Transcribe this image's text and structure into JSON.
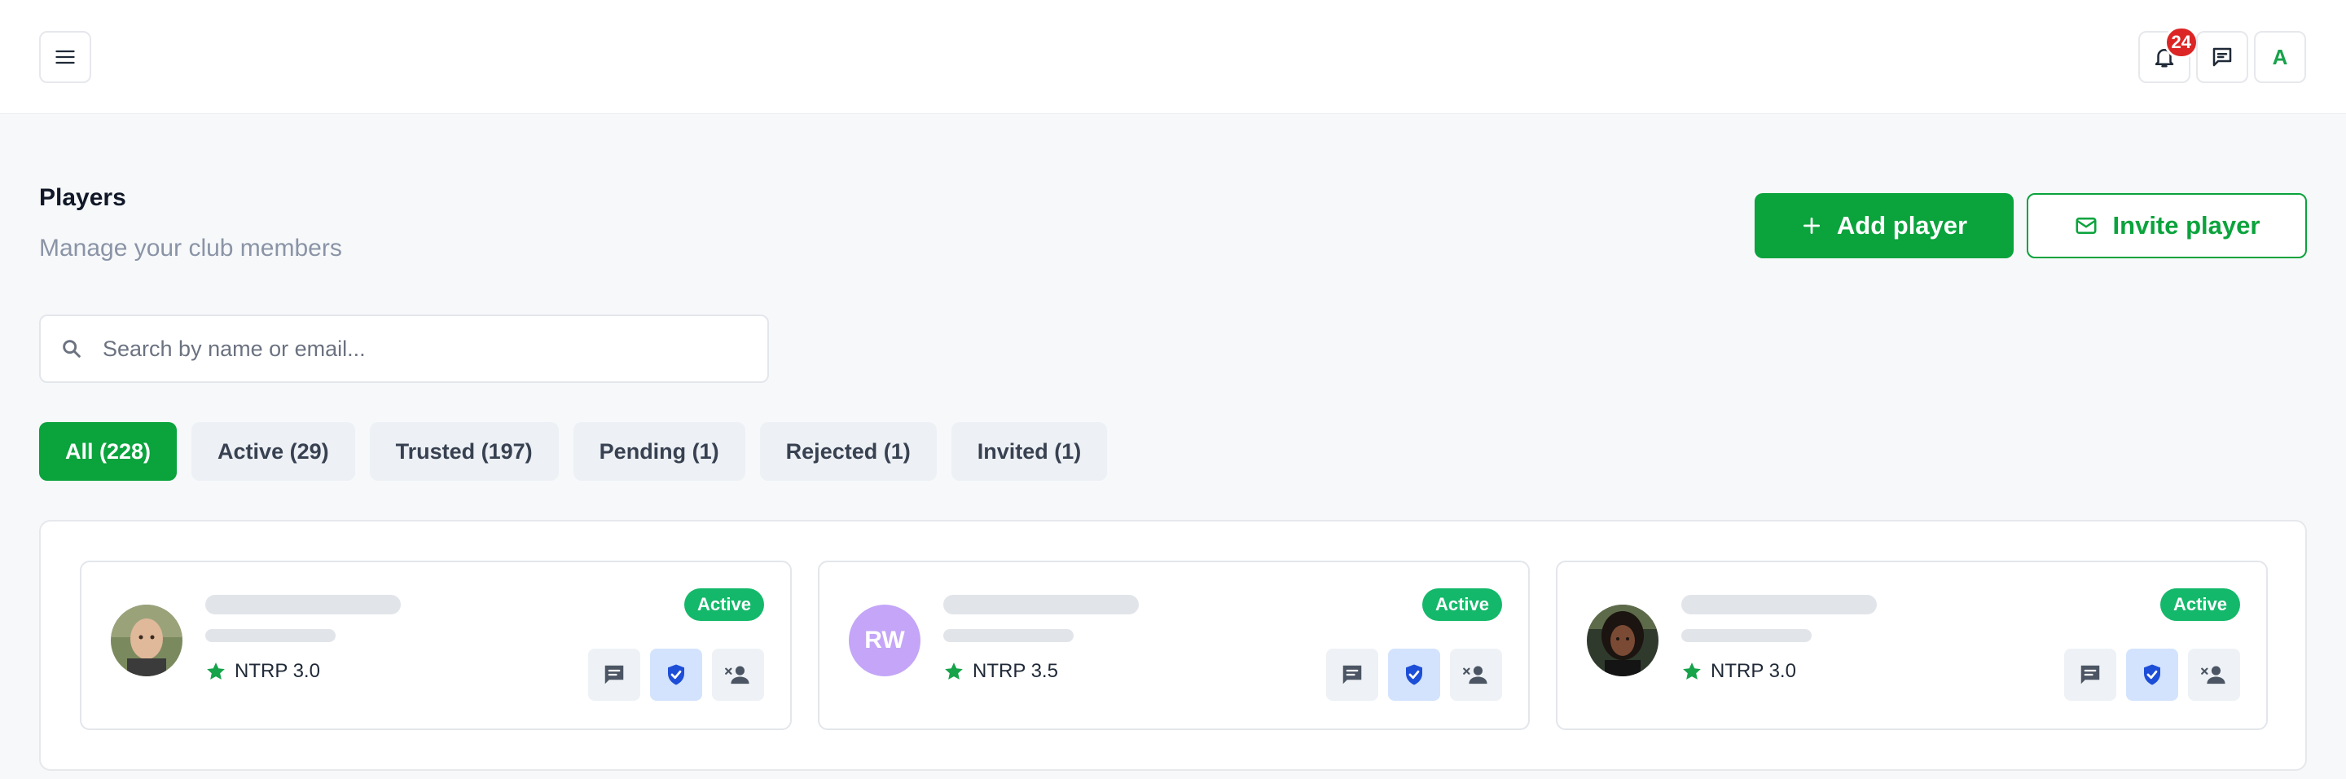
{
  "header": {
    "notifications_count": "24",
    "user_initial": "A"
  },
  "page": {
    "title": "Players",
    "subtitle": "Manage your club members",
    "add_button": "Add player",
    "invite_button": "Invite player"
  },
  "search": {
    "placeholder": "Search by name or email...",
    "value": ""
  },
  "tabs": [
    {
      "label": "All (228)",
      "active": true
    },
    {
      "label": "Active (29)",
      "active": false
    },
    {
      "label": "Trusted (197)",
      "active": false
    },
    {
      "label": "Pending (1)",
      "active": false
    },
    {
      "label": "Rejected (1)",
      "active": false
    },
    {
      "label": "Invited (1)",
      "active": false
    }
  ],
  "players": [
    {
      "avatar": "photo",
      "initials": "",
      "rating": "NTRP 3.0",
      "status": "Active"
    },
    {
      "avatar": "initials",
      "initials": "RW",
      "rating": "NTRP 3.5",
      "status": "Active"
    },
    {
      "avatar": "photo",
      "initials": "",
      "rating": "NTRP 3.0",
      "status": "Active"
    }
  ],
  "icons": {
    "menu": "hamburger-menu-icon",
    "bell": "bell-icon",
    "chat": "chat-icon",
    "plus": "plus-icon",
    "mail": "mail-icon",
    "search": "search-icon",
    "star": "star-icon",
    "message": "message-icon",
    "shield": "shield-check-icon",
    "remove_user": "remove-user-icon"
  },
  "colors": {
    "brand_green": "#0aa33c",
    "status_green": "#14b86a",
    "badge_red": "#dc2626",
    "trust_blue": "#1d4ed8"
  }
}
